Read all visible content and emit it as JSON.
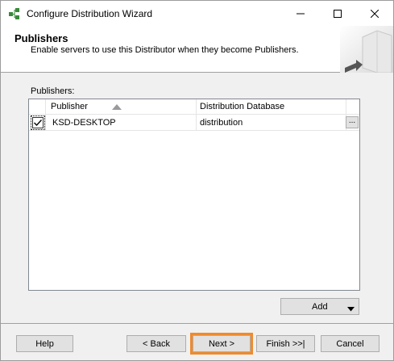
{
  "window": {
    "title": "Configure Distribution Wizard",
    "icon": "wizard-icon",
    "controls": [
      "minimize-icon",
      "maximize-icon",
      "close-icon"
    ]
  },
  "header": {
    "title": "Publishers",
    "subtitle": "Enable servers to use this Distributor when they become Publishers."
  },
  "publishers": {
    "label": "Publishers:",
    "columns": [
      "Publisher",
      "Distribution Database"
    ],
    "sort": "ascending",
    "rows": [
      {
        "checked": true,
        "publisher": "KSD-DESKTOP",
        "database": "distribution",
        "browse": "..."
      }
    ]
  },
  "add_button": {
    "label": "Add",
    "arrow": "▼"
  },
  "footer": {
    "help": "Help",
    "back": "< Back",
    "next": "Next >",
    "finish": "Finish >>|",
    "cancel": "Cancel"
  },
  "colors": {
    "highlight": "#f08a2a"
  }
}
